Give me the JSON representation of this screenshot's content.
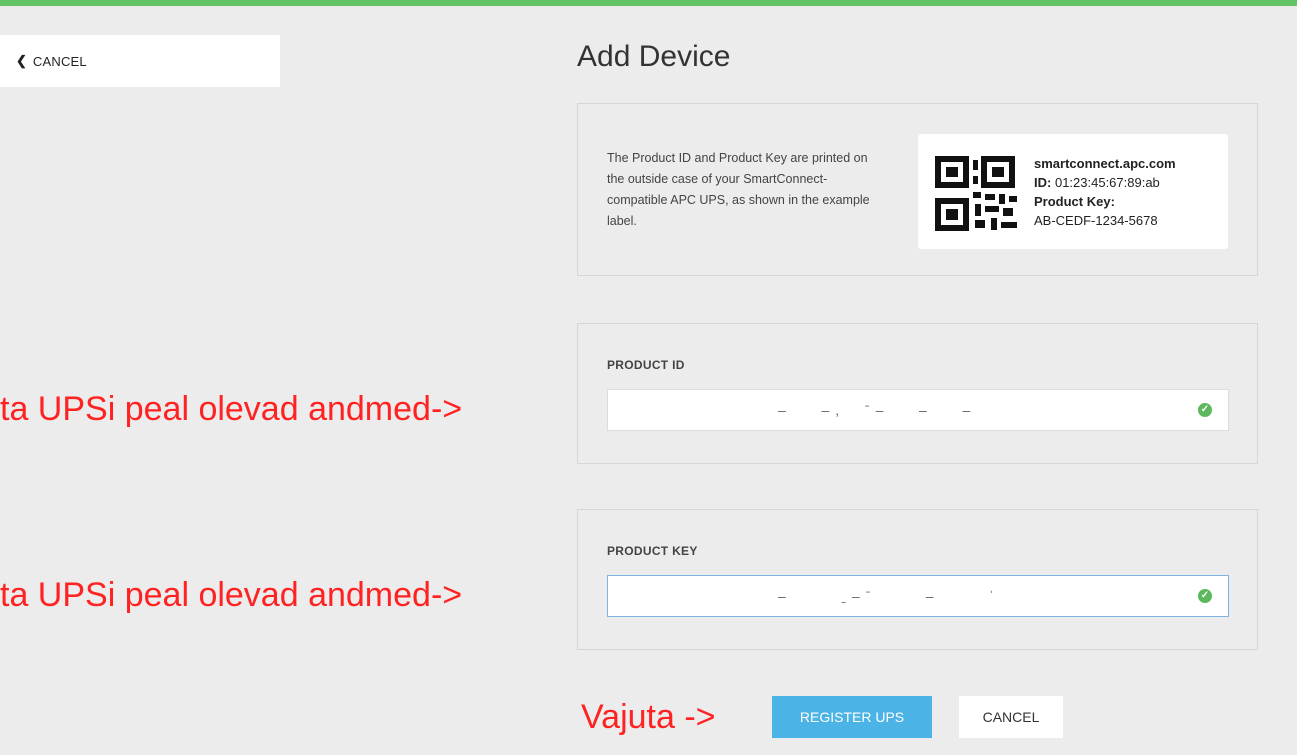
{
  "nav": {
    "cancel_icon": "chevron-left-icon",
    "cancel_label": "CANCEL"
  },
  "page": {
    "title": "Add Device"
  },
  "info": {
    "text": "The Product ID and Product Key are printed on the outside case of your SmartConnect-compatible APC UPS, as shown in the example label.",
    "label": {
      "site": "smartconnect.apc.com",
      "id_prefix": "ID:",
      "id_value": "01:23:45:67:89:ab",
      "key_prefix": "Product Key:",
      "key_value": "AB-CEDF-1234-5678"
    }
  },
  "form": {
    "product_id": {
      "label": "PRODUCT ID",
      "value": "–   –,  ˉ–   –   –"
    },
    "product_key": {
      "label": "PRODUCT KEY",
      "value": "–     ˍ–ˉ     –     ˈ"
    }
  },
  "annotations": {
    "line1": "ta UPSi peal olevad andmed->",
    "line2": "ta UPSi peal olevad andmed->",
    "line3": "Vajuta ->"
  },
  "actions": {
    "register_label": "REGISTER UPS",
    "cancel_label": "CANCEL"
  },
  "colors": {
    "accent": "#4cb3e6",
    "topbar": "#62c462",
    "annotation": "#ff2222",
    "success": "#5cb85c"
  }
}
